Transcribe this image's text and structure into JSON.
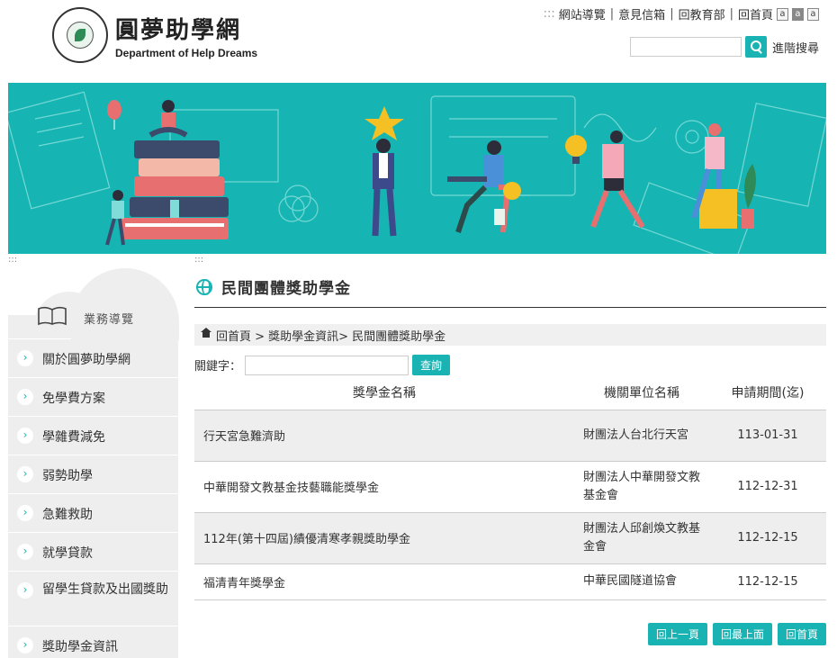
{
  "header": {
    "title_zh": "圓夢助學網",
    "title_en": "Department of Help Dreams",
    "accesskey": ":::",
    "links": [
      "網站導覽",
      "意見信箱",
      "回教育部",
      "回首頁"
    ],
    "font_sizes": [
      "a",
      "a",
      "a"
    ],
    "search_placeholder": "",
    "advanced_search": "進階搜尋"
  },
  "accesskeys": {
    "left": ":::",
    "main": ":::"
  },
  "sidebar": {
    "title": "業務導覽",
    "items": [
      {
        "label": "關於圓夢助學網"
      },
      {
        "label": "免學費方案"
      },
      {
        "label": "學雜費減免"
      },
      {
        "label": "弱勢助學"
      },
      {
        "label": "急難救助"
      },
      {
        "label": "就學貸款"
      },
      {
        "label": "留學生貸款及出國獎助"
      },
      {
        "label": "獎助學金資訊"
      }
    ]
  },
  "main": {
    "page_title": "民間團體獎助學金",
    "breadcrumb": "回首頁 > 獎助學金資訊> 民間團體獎助學金",
    "keyword_label": "關鍵字：",
    "query_button": "查詢",
    "table": {
      "headers": [
        "獎學金名稱",
        "機關單位名稱",
        "申請期間(迄)"
      ],
      "rows": [
        {
          "name": "行天宮急難濟助",
          "org": "財團法人台北行天宮",
          "date": "113-01-31"
        },
        {
          "name": "中華開發文教基金技藝職能獎學金",
          "org": "財團法人中華開發文教基金會",
          "date": "112-12-31"
        },
        {
          "name": "112年(第十四屆)績優清寒孝親獎助學金",
          "org": "財團法人邱創煥文教基金會",
          "date": "112-12-15"
        },
        {
          "name": "福清青年獎學金",
          "org": "中華民國隧道協會",
          "date": "112-12-15"
        }
      ]
    },
    "pager": [
      "回上一頁",
      "回最上面",
      "回首頁"
    ]
  },
  "colors": {
    "accent": "#1ab3b3",
    "banner": "#16b5b3",
    "sidebar_bg": "#eeeeee"
  }
}
